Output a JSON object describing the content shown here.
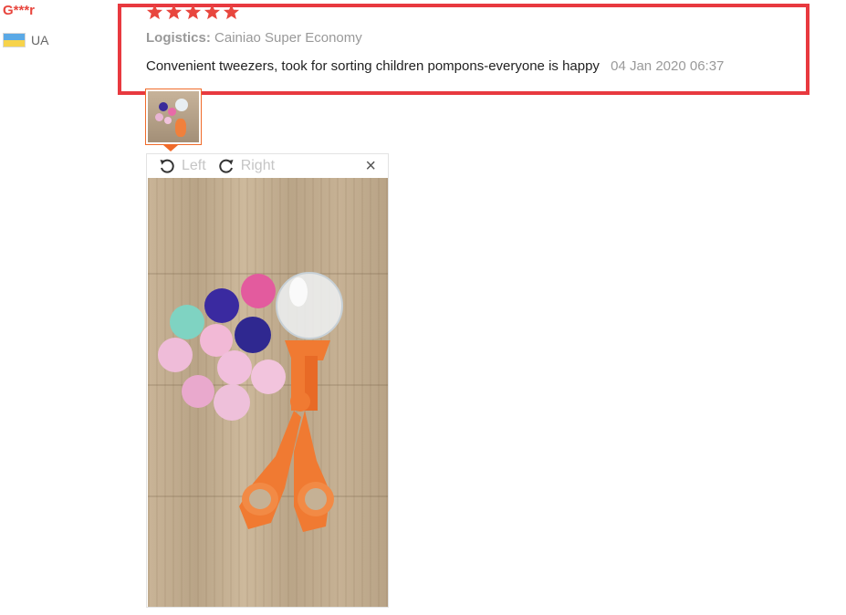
{
  "reviewer": {
    "name": "G***r",
    "country_code": "UA",
    "flag": "ukraine-flag"
  },
  "review": {
    "rating": 5,
    "rating_stars": [
      "★",
      "★",
      "★",
      "★",
      "★"
    ],
    "logistics_label": "Logistics:",
    "logistics_value": "Cainiao Super Economy",
    "text": "Convenient tweezers, took for sorting children pompons-everyone is happy",
    "date": "04 Jan 2020 06:37"
  },
  "image_viewer": {
    "rotate_left_label": "Left",
    "rotate_right_label": "Right",
    "close_glyph": "×"
  },
  "colors": {
    "accent": "#e8463e",
    "highlight": "#e8393f",
    "thumb_border": "#f06b2a"
  }
}
